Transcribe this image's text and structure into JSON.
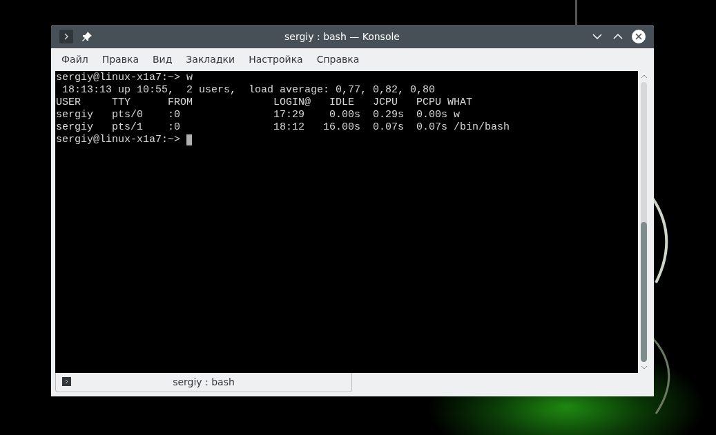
{
  "window": {
    "title": "sergiy : bash — Konsole"
  },
  "menu": [
    "Файл",
    "Правка",
    "Вид",
    "Закладки",
    "Настройка",
    "Справка"
  ],
  "terminal": {
    "lines": [
      "sergiy@linux-x1a7:~> w",
      " 18:13:13 up 10:55,  2 users,  load average: 0,77, 0,82, 0,80",
      "USER     TTY      FROM             LOGIN@   IDLE   JCPU   PCPU WHAT",
      "sergiy   pts/0    :0               17:29    0.00s  0.29s  0.00s w",
      "sergiy   pts/1    :0               18:12   16.00s  0.07s  0.07s /bin/bash",
      "sergiy@linux-x1a7:~> "
    ]
  },
  "tabs": [
    {
      "label": "sergiy : bash",
      "selected": true
    }
  ]
}
